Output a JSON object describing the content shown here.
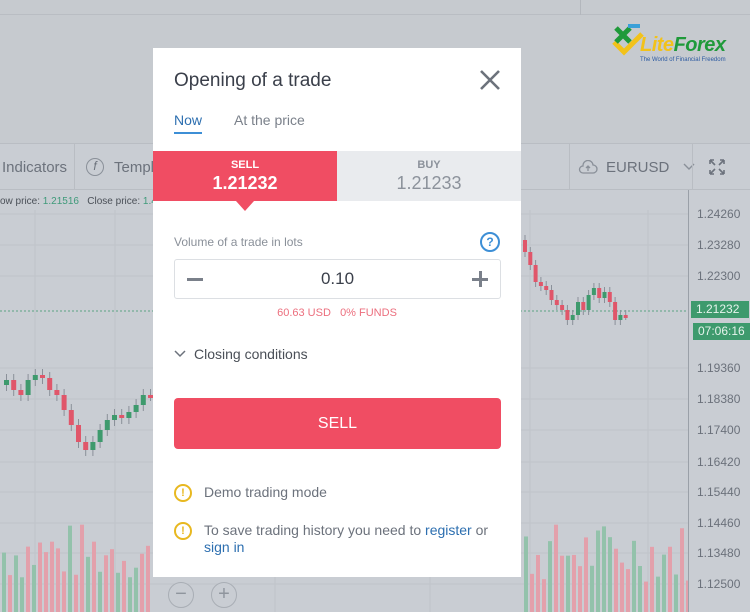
{
  "background": {
    "toolbar": {
      "indicators": "Indicators",
      "templates": "Templ",
      "symbol": "EURUSD"
    },
    "info": {
      "low_label": "ow price:",
      "low_value": "1.21516",
      "close_label": "Close price:",
      "close_value": "1.4"
    },
    "price_axis": [
      "1.24260",
      "1.23280",
      "1.22300",
      "1.19360",
      "1.18380",
      "1.17400",
      "1.16420",
      "1.15440",
      "1.14460",
      "1.13480",
      "1.12500"
    ],
    "current_price": "1.21232",
    "countdown": "07:06:16",
    "logo": {
      "name_a": "Lite",
      "name_b": "Forex",
      "tagline": "The World of Financial Freedom"
    },
    "zoom_out": "−",
    "zoom_in": "+"
  },
  "modal": {
    "title": "Opening of a trade",
    "tabs": [
      {
        "label": "Now",
        "active": true
      },
      {
        "label": "At the price",
        "active": false
      }
    ],
    "sell": {
      "label": "SELL",
      "price": "1.21232"
    },
    "buy": {
      "label": "BUY",
      "price": "1.21233"
    },
    "volume_label": "Volume of a trade in lots",
    "volume_value": "0.10",
    "margin": "60.63 USD",
    "funds": "0% FUNDS",
    "closing_conditions": "Closing conditions",
    "sell_button": "SELL",
    "notes": {
      "demo": "Demo trading mode",
      "history_text": "To save trading history you need to",
      "register": "register",
      "or": "or",
      "sign_in": "sign in"
    }
  },
  "colors": {
    "sell": "#f04d63",
    "accent": "#3d8fd6",
    "up": "#3e9a6d",
    "down": "#e0566a"
  }
}
